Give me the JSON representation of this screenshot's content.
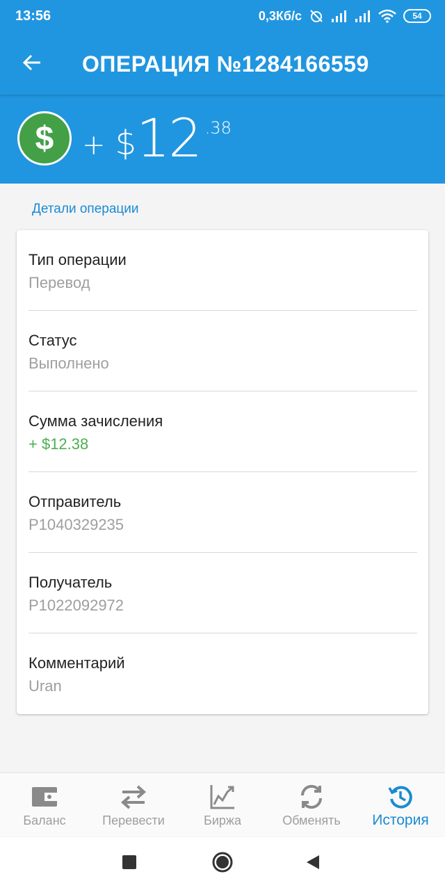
{
  "status_bar": {
    "time": "13:56",
    "network_speed": "0,3Кб/с",
    "battery": "54"
  },
  "app_bar": {
    "back_icon": "arrow-left-icon",
    "title": "ОПЕРАЦИЯ №1284166559"
  },
  "amount": {
    "icon": "dollar-coin-icon",
    "icon_symbol": "$",
    "sign": "+",
    "currency": "$",
    "integer": "12",
    "fraction": ".38"
  },
  "details": {
    "section_title": "Детали операции",
    "rows": [
      {
        "label": "Тип операции",
        "value": "Перевод"
      },
      {
        "label": "Статус",
        "value": "Выполнено"
      },
      {
        "label": "Сумма зачисления",
        "value": "+ $12.38"
      },
      {
        "label": "Отправитель",
        "value": "P1040329235"
      },
      {
        "label": "Получатель",
        "value": "P1022092972"
      },
      {
        "label": "Комментарий",
        "value": "Uran"
      }
    ]
  },
  "bottom_nav": {
    "items": [
      {
        "label": "Баланс",
        "icon": "wallet-icon"
      },
      {
        "label": "Перевести",
        "icon": "transfer-arrows-icon"
      },
      {
        "label": "Биржа",
        "icon": "chart-icon"
      },
      {
        "label": "Обменять",
        "icon": "refresh-icon"
      },
      {
        "label": "История",
        "icon": "history-icon",
        "active": true
      }
    ]
  },
  "colors": {
    "primary": "#2196e0",
    "accent_blue": "#1a8bd3",
    "positive_green": "#4caf50",
    "coin_green": "#43a047"
  }
}
